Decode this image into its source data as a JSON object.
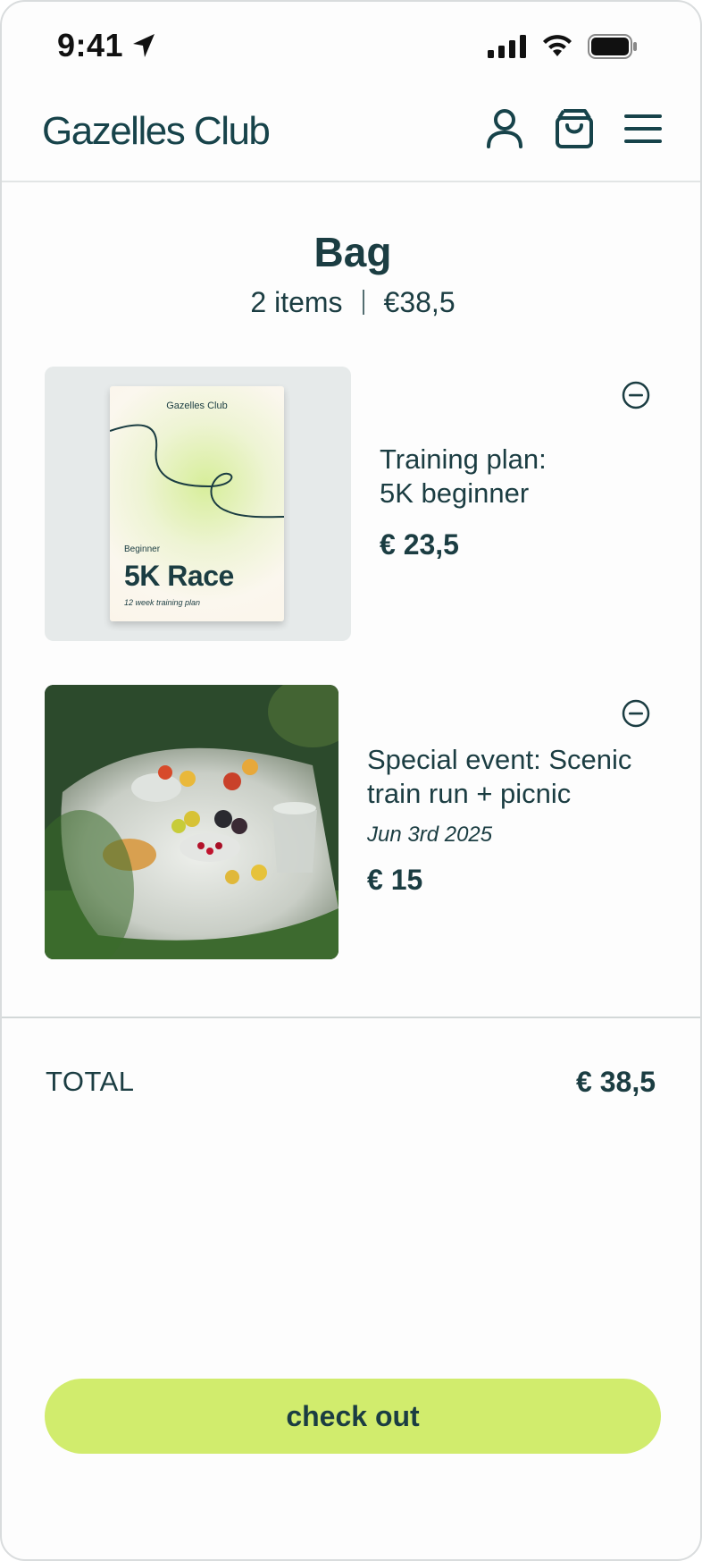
{
  "status_bar": {
    "time": "9:41"
  },
  "header": {
    "logo": "Gazelles Club",
    "icons": [
      "user-icon",
      "shopping-bag-icon",
      "hamburger-menu-icon"
    ]
  },
  "bag": {
    "title": "Bag",
    "item_count": "2 items",
    "subtotal": "€38,5"
  },
  "items": [
    {
      "name_line1": "Training plan:",
      "name_line2": "5K beginner",
      "price": "€ 23,5",
      "booklet": {
        "brand": "Gazelles Club",
        "level": "Beginner",
        "title": "5K Race",
        "subtitle": "12 week training plan"
      }
    },
    {
      "name_line1": "Special event: Scenic",
      "name_line2": "train run + picnic",
      "date": "Jun 3rd 2025",
      "price": "€ 15"
    }
  ],
  "total": {
    "label": "TOTAL",
    "value": "€ 38,5"
  },
  "checkout_label": "check out",
  "colors": {
    "primary_text": "#1b3d42",
    "accent": "#d1ec6d",
    "divider": "#d3d8d8"
  }
}
